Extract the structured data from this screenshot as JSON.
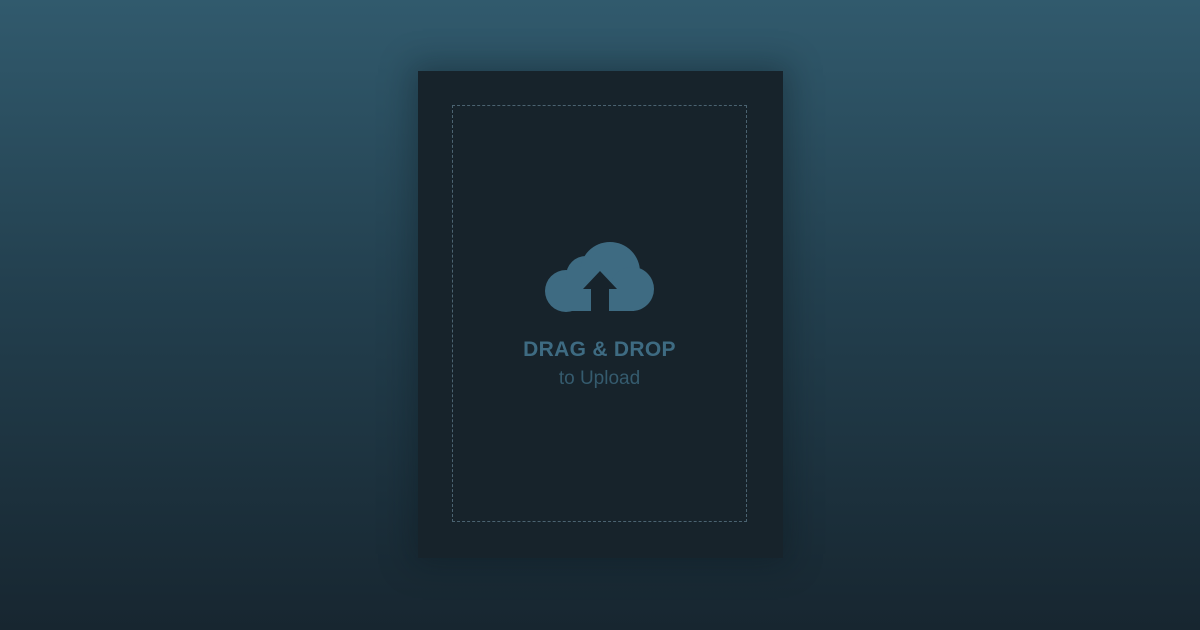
{
  "upload": {
    "title": "DRAG & DROP",
    "subtitle": "to Upload",
    "icon": "cloud-upload-icon"
  },
  "colors": {
    "background_top": "#315a6d",
    "background_bottom": "#172630",
    "card": "#17232b",
    "accent": "#3e6b82",
    "dashed_border": "#4b6371"
  }
}
